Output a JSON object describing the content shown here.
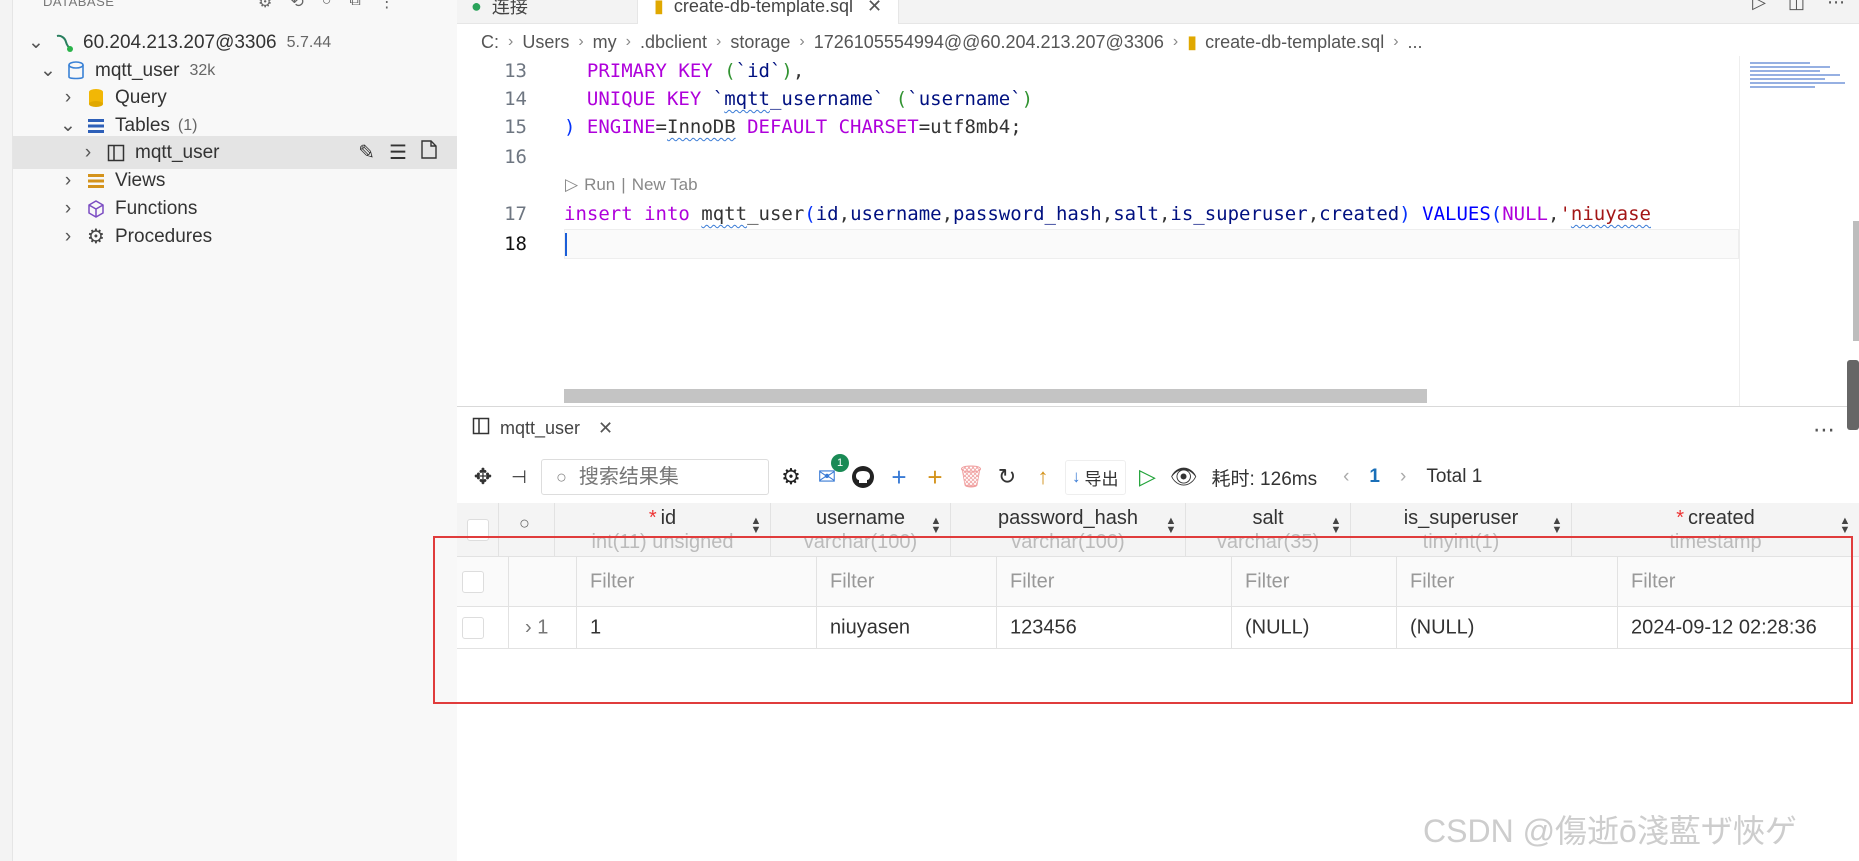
{
  "sidebar": {
    "header_label": "DATABASE",
    "connection": {
      "host": "60.204.213.207@3306",
      "version": "5.7.44"
    },
    "database": {
      "name": "mqtt_user",
      "size": "32k"
    },
    "items": [
      {
        "label": "Query"
      },
      {
        "label": "Tables",
        "count": "(1)"
      },
      {
        "label": "mqtt_user"
      },
      {
        "label": "Views"
      },
      {
        "label": "Functions"
      },
      {
        "label": "Procedures"
      }
    ]
  },
  "tabs": [
    {
      "label": "连接"
    },
    {
      "label": "create-db-template.sql",
      "active": true
    }
  ],
  "breadcrumb": [
    "C:",
    "Users",
    "my",
    ".dbclient",
    "storage",
    "1726105554994@@60.204.213.207@3306",
    "create-db-template.sql",
    "..."
  ],
  "editor": {
    "lines": [
      {
        "num": "13",
        "text": "  PRIMARY KEY (`id`),"
      },
      {
        "num": "14",
        "text": "  UNIQUE KEY `mqtt_username` (`username`)"
      },
      {
        "num": "15",
        "text": ") ENGINE=InnoDB DEFAULT CHARSET=utf8mb4;"
      },
      {
        "num": "16",
        "text": ""
      },
      {
        "num": "17",
        "text": "insert into mqtt_user(id,username,password_hash,salt,is_superuser,created) VALUES(NULL,'niuyase"
      },
      {
        "num": "18",
        "text": ""
      }
    ],
    "codelens": {
      "run": "Run",
      "sep": "|",
      "new_tab": "New Tab"
    }
  },
  "panel": {
    "tab_label": "mqtt_user",
    "search_placeholder": "搜索结果集",
    "notification_count": "1",
    "export_label": "导出",
    "elapsed": "耗时: 126ms",
    "page": "1",
    "total": "Total 1"
  },
  "grid": {
    "columns": [
      {
        "name": "id",
        "type": "int(11) unsigned",
        "required": true
      },
      {
        "name": "username",
        "type": "varchar(100)",
        "required": false
      },
      {
        "name": "password_hash",
        "type": "varchar(100)",
        "required": false
      },
      {
        "name": "salt",
        "type": "varchar(35)",
        "required": false
      },
      {
        "name": "is_superuser",
        "type": "tinyint(1)",
        "required": false
      },
      {
        "name": "created",
        "type": "timestamp",
        "required": true
      }
    ],
    "filter_placeholder": "Filter",
    "rows": [
      {
        "row_num": "1",
        "cells": [
          "1",
          "niuyasen",
          "123456",
          "(NULL)",
          "(NULL)",
          "2024-09-12 02:28:36"
        ]
      }
    ]
  },
  "watermark": "CSDN @傷逝ō淺藍ザ悏ゲ",
  "colors": {
    "highlight_box": "#e03c3c",
    "accent": "#1a6fb8",
    "run_green": "#22a33a"
  }
}
